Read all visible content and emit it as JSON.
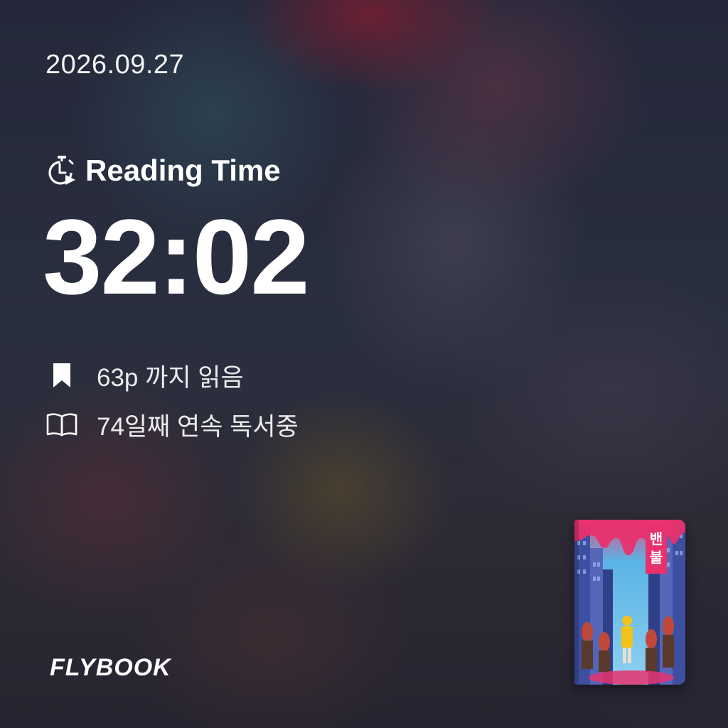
{
  "date": "2026.09.27",
  "reading_time": {
    "label": "Reading Time",
    "icon": "stopwatch-play-icon",
    "value": "32:02"
  },
  "stats": [
    {
      "icon": "bookmark-icon",
      "text": "63p 까지 읽음"
    },
    {
      "icon": "open-book-icon",
      "text": "74일째 연속 독서중"
    }
  ],
  "brand": {
    "logo": "FLYBOOK"
  },
  "book_cover": {
    "description_icon": "book-cover-image",
    "colors": {
      "sky": "#5ab4e6",
      "accent": "#e8326e",
      "building": "#3d4fa0",
      "figure": "#f2c21b"
    }
  }
}
